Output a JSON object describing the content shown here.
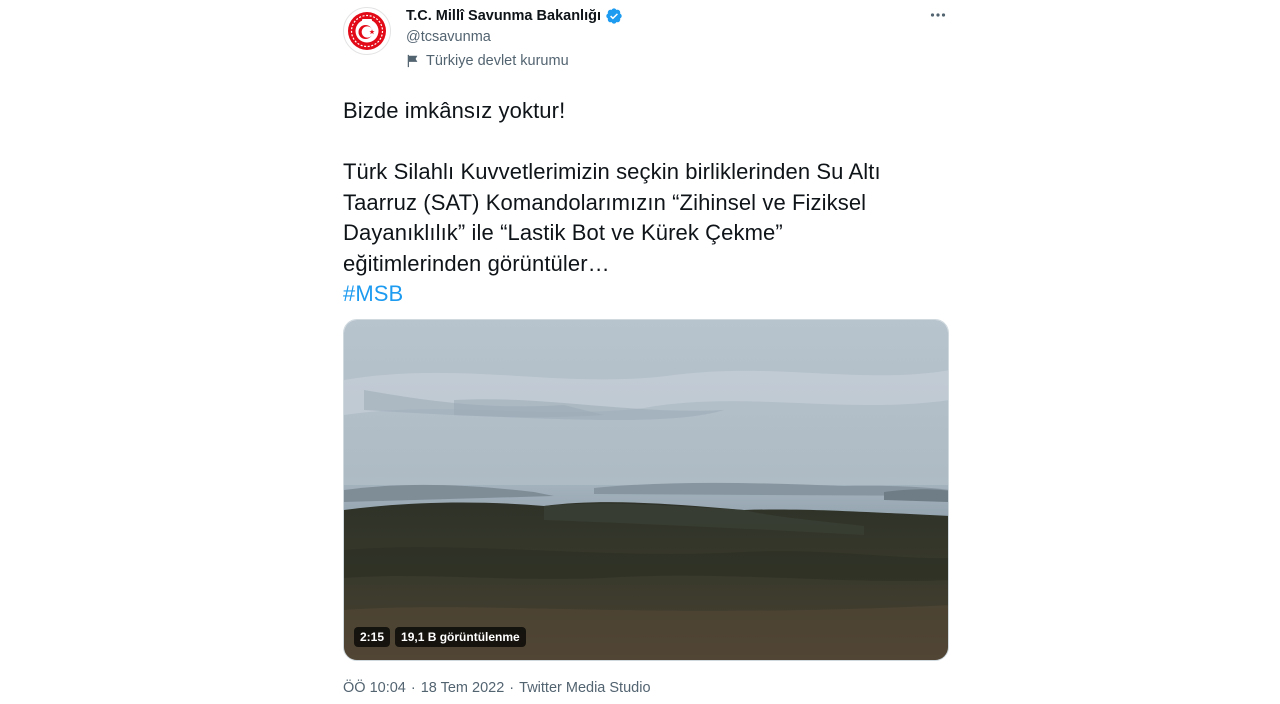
{
  "author": {
    "display_name": "T.C. Millî Savunma Bakanlığı",
    "handle": "@tcsavunma",
    "affiliation": "Türkiye devlet kurumu",
    "verified_icon": "verified-badge-icon",
    "avatar_icon": "ministry-emblem-icon"
  },
  "tweet": {
    "line1": "Bizde imkânsız yoktur!",
    "paragraph_l1": "Türk Silahlı Kuvvetlerimizin seçkin birliklerinden Su Altı",
    "paragraph_l2": "Taarruz (SAT) Komandolarımızın “Zihinsel ve Fiziksel",
    "paragraph_l3": "Dayanıklılık” ile “Lastik Bot ve Kürek Çekme”",
    "paragraph_l4": "eğitimlerinden görüntüler…",
    "hashtag": "#MSB"
  },
  "media": {
    "duration": "2:15",
    "views": "19,1 B görüntülenme"
  },
  "meta": {
    "time": "ÖÖ 10:04",
    "date": "18 Tem 2022",
    "source": "Twitter Media Studio",
    "separator": "·"
  },
  "colors": {
    "accent": "#1d9bf0",
    "text": "#0f1419",
    "secondary": "#536471",
    "emblem_red": "#e30a17"
  }
}
